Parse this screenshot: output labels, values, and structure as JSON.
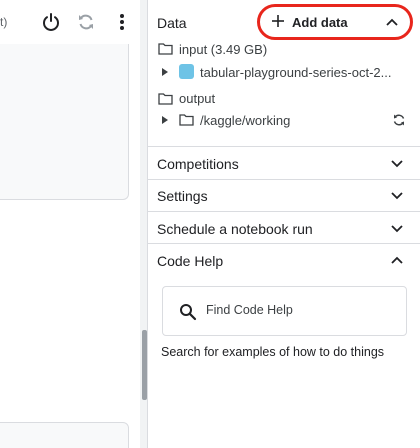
{
  "left_panel": {
    "toolbar_label": "t)",
    "power_icon": "power-icon",
    "refresh_icon": "refresh-icon",
    "more_icon": "more-vert-icon"
  },
  "data_panel": {
    "title": "Data",
    "add_data_label": "Add data",
    "input": {
      "label": "input (3.49 GB)",
      "dataset": "tabular-playground-series-oct-2..."
    },
    "output": {
      "label": "output",
      "path": "/kaggle/working"
    }
  },
  "sections": [
    {
      "title": "Competitions"
    },
    {
      "title": "Settings"
    },
    {
      "title": "Schedule a notebook run"
    },
    {
      "title": "Code Help"
    }
  ],
  "code_help": {
    "search_placeholder": "Find Code Help",
    "description": "Search for examples of how to do things"
  },
  "colors": {
    "highlight_ring": "#e8261c",
    "dataset_icon": "#6ec3e6",
    "divider": "#dadce0"
  }
}
